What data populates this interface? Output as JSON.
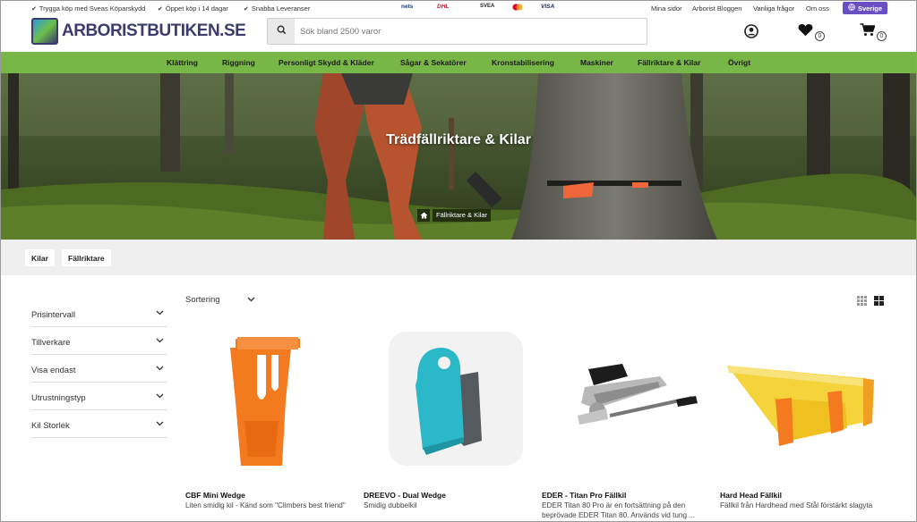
{
  "topbar": {
    "usps": [
      "Trygga köp med Sveas Köparskydd",
      "Öppet köp i 14 dagar",
      "Snabba Leveranser"
    ],
    "payments": [
      "nets",
      "DHL",
      "SVEA",
      "VISA"
    ],
    "links": [
      "Mina sidor",
      "Arborist Bloggen",
      "Vanliga frågor",
      "Om oss"
    ],
    "country": "Sverige"
  },
  "header": {
    "logo_text": "ARBORISTBUTIKEN.SE",
    "search_placeholder": "Sök bland 2500 varor",
    "wishlist_count": "0",
    "cart_count": "0"
  },
  "nav": {
    "items": [
      "Klättring",
      "Riggning",
      "Personligt Skydd & Kläder",
      "Sågar & Sekatörer",
      "Kronstabilisering",
      "Maskiner",
      "Fällriktare & Kilar",
      "Övrigt"
    ]
  },
  "hero": {
    "title": "Trädfällriktare & Kilar",
    "breadcrumb_current": "Fällriktare & Kilar"
  },
  "tags": [
    "Kilar",
    "Fällriktare"
  ],
  "filters": [
    "Prisintervall",
    "Tillverkare",
    "Visa endast",
    "Utrustningstyp",
    "Kil Storlek"
  ],
  "sort_label": "Sortering",
  "products": [
    {
      "name": "CBF Mini Wedge",
      "desc": "Liten smidig kil - Känd som \"Climbers best friend\""
    },
    {
      "name": "DREEVO - Dual Wedge",
      "desc": "Smidig dubbelkil"
    },
    {
      "name": "EDER - Titan Pro Fällkil",
      "desc": "EDER Titan 80 Pro är en fortsättning på den beprövade EDER Titan 80. Används vid tung ..."
    },
    {
      "name": "Hard Head Fällkil",
      "desc": "Fällkil från Hardhead med Stål förstärkt slagyta"
    }
  ],
  "colors": {
    "nav": "#79b648",
    "brand": "#3b3b6e",
    "country_btn": "#6a4fc2",
    "wedge_orange": "#f47a20",
    "wedge_teal": "#2cb8c9"
  }
}
